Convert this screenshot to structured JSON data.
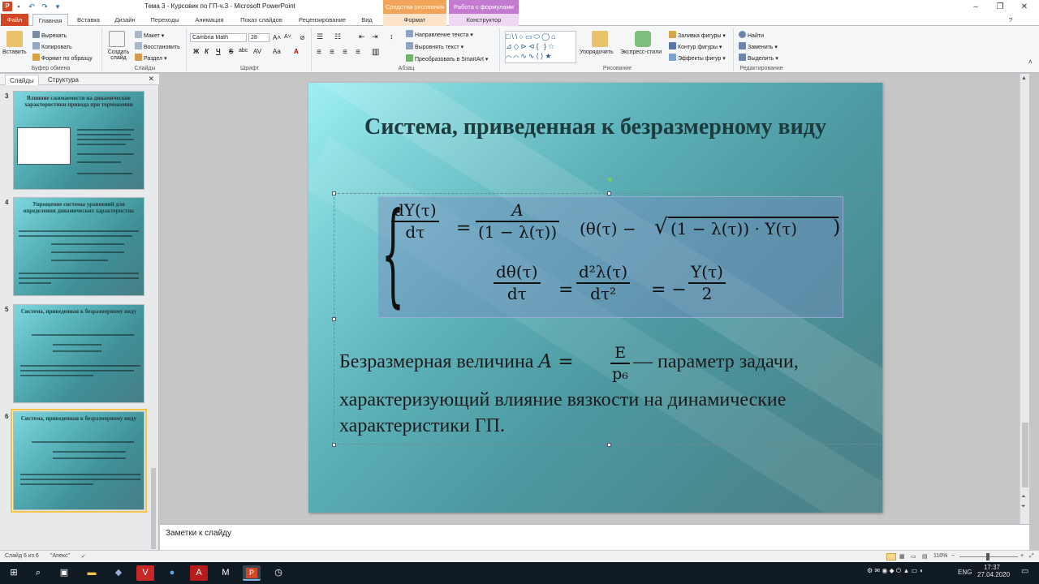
{
  "window": {
    "title": "Тема 3 - Курсовик по ГП-ч.3 - Microsoft PowerPoint",
    "ctx_drawing": "Средства рисования",
    "ctx_formula": "Работа с формулами",
    "min": "–",
    "restore": "❐",
    "close": "✕",
    "app_icon": "P"
  },
  "tabs": [
    {
      "label": "Файл"
    },
    {
      "label": "Главная"
    },
    {
      "label": "Вставка"
    },
    {
      "label": "Дизайн"
    },
    {
      "label": "Переходы"
    },
    {
      "label": "Анимация"
    },
    {
      "label": "Показ слайдов"
    },
    {
      "label": "Рецензирование"
    },
    {
      "label": "Вид"
    },
    {
      "label": "Формат"
    },
    {
      "label": "Конструктор"
    }
  ],
  "ribbon": {
    "clipboard": {
      "paste": "Вставить",
      "cut": "Вырезать",
      "copy": "Копировать",
      "format_painter": "Формат по образцу",
      "label": "Буфер обмена"
    },
    "slides": {
      "new": "Создать слайд",
      "layout": "Макет",
      "reset": "Восстановить",
      "section": "Раздел",
      "label": "Слайды"
    },
    "font": {
      "name": "Cambria Math",
      "size": "28",
      "label": "Шрифт",
      "bold": "Ж",
      "italic": "К",
      "underline": "Ч",
      "strike": "S",
      "shadow": "abc"
    },
    "paragraph": {
      "direction": "Направление текста",
      "align": "Выровнять текст",
      "smartart": "Преобразовать в SmartArt",
      "label": "Абзац"
    },
    "drawing": {
      "arrange": "Упорядочить",
      "quick_styles": "Экспресс-стили",
      "fill": "Заливка фигуры",
      "outline": "Контур фигуры",
      "effects": "Эффекты фигур",
      "label": "Рисование"
    },
    "editing": {
      "find": "Найти",
      "replace": "Заменить",
      "select": "Выделить",
      "label": "Редактирование"
    }
  },
  "left_pane": {
    "tab_slides": "Слайды",
    "tab_outline": "Структура",
    "close": "✕",
    "thumbs": [
      {
        "num": "3",
        "title": "Влияние сжимаемости на динамические характеристики привода при торможении"
      },
      {
        "num": "4",
        "title": "Упрощение системы уравнений для определения динамических характеристик"
      },
      {
        "num": "5",
        "title": "Система, приведенная к безразмерному виду"
      },
      {
        "num": "6",
        "title": "Система, приведенная к безразмерному виду"
      }
    ]
  },
  "slide": {
    "title": "Система, приведенная к безразмерному виду",
    "eq1_lhs_num": "dY(τ)",
    "eq1_lhs_den": "dτ",
    "eq1_rhs_num": "A",
    "eq1_rhs_den": "(1 − λ(τ))",
    "eq1_tail_a": "(θ(τ) − ",
    "eq1_sqrt": "(1 − λ(τ)) · Y(τ)",
    "eq1_tail_b": ")",
    "eq2_a_num": "dθ(τ)",
    "eq2_a_den": "dτ",
    "eq2_b_num": "d²λ(τ)",
    "eq2_b_den": "dτ²",
    "eq2_c_num": "Y(τ)",
    "eq2_c_den": "2",
    "eq_sign": "=",
    "minus_sign": "= −",
    "body_line1_a": "Безразмерная величина ",
    "body_A": "A =",
    "body_frac_num": "E",
    "body_frac_den": "p₆",
    "body_line1_b": "— параметр задачи,",
    "body_line2": "характеризующий влияние вязкости на динамические",
    "body_line3": "характеристики ГП."
  },
  "notes": {
    "placeholder": "Заметки к слайду"
  },
  "status": {
    "slide_of": "Слайд 6 из 6",
    "theme": "\"Апекс\"",
    "lang_icon": "✓",
    "zoom": "110%"
  },
  "taskbar": {
    "time": "17:37",
    "date": "27.04.2020",
    "lang": "ENG"
  }
}
